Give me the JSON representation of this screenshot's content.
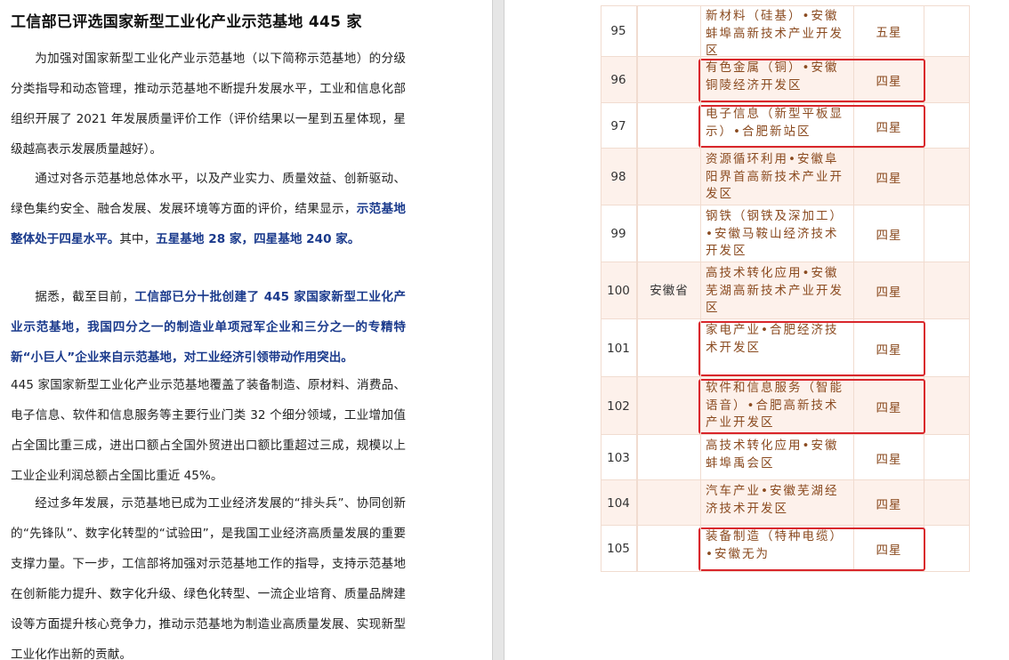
{
  "document": {
    "title": "工信部已评选国家新型工业化产业示范基地 445 家",
    "p1": "为加强对国家新型工业化产业示范基地（以下简称示范基地）的分级分类指导和动态管理，推动示范基地不断提升发展水平，工业和信息化部组织开展了 2021 年发展质量评价工作（评价结果以一星到五星体现，星级越高表示发展质量越好）。",
    "p2_plain": "通过对各示范基地总体水平，以及产业实力、质量效益、创新驱动、绿色集约安全、融合发展、发展环境等方面的评价，结果显示，",
    "p2_em1": "示范基地整体处于四星水平。",
    "p2_plain2": "其中，",
    "p2_em2": "五星基地 28 家，四星基地 240 家。",
    "p3_plain": "据悉，截至目前，",
    "p3_em": "工信部已分十批创建了 445 家国家新型工业化产业示范基地，我国四分之一的制造业单项冠军企业和三分之一的专精特新“小巨人”企业来自示范基地，对工业经济引领带动作用突出。",
    "p4": "445 家国家新型工业化产业示范基地覆盖了装备制造、原材料、消费品、电子信息、软件和信息服务等主要行业门类 32 个细分领域，工业增加值占全国比重三成，进出口额占全国外贸进出口额比重超过三成，规模以上工业企业利润总额占全国比重近 45%。",
    "p5": "经过多年发展，示范基地已成为工业经济发展的“排头兵”、协同创新的“先锋队”、数字化转型的“试验田”，是我国工业经济高质量发展的重要支撑力量。下一步，工信部将加强对示范基地工作的指导，支持示范基地在创新能力提升、数字化升级、绿色化转型、一流企业培育、质量品牌建设等方面提升核心竞争力，推动示范基地为制造业高质量发展、实现新型工业化作出新的贡献。"
  },
  "table": {
    "province": "安徽省",
    "rows": [
      {
        "idx": "95",
        "name": "新材料（硅基）•安徽蚌埠高新技术产业开发区",
        "star": "五星",
        "highlight": false
      },
      {
        "idx": "96",
        "name": "有色金属（铜）•安徽铜陵经济开发区",
        "star": "四星",
        "highlight": true
      },
      {
        "idx": "97",
        "name": "电子信息（新型平板显示）•合肥新站区",
        "star": "四星",
        "highlight": true
      },
      {
        "idx": "98",
        "name": "资源循环利用•安徽阜阳界首高新技术产业开发区",
        "star": "四星",
        "highlight": false
      },
      {
        "idx": "99",
        "name": "钢铁（钢铁及深加工）•安徽马鞍山经济技术开发区",
        "star": "四星",
        "highlight": false
      },
      {
        "idx": "100",
        "name": "高技术转化应用•安徽芜湖高新技术产业开发区",
        "star": "四星",
        "highlight": false
      },
      {
        "idx": "101",
        "name": "家电产业•合肥经济技术开发区",
        "star": "四星",
        "highlight": true
      },
      {
        "idx": "102",
        "name": "软件和信息服务（智能语音）•合肥高新技术产业开发区",
        "star": "四星",
        "highlight": true
      },
      {
        "idx": "103",
        "name": "高技术转化应用•安徽蚌埠禹会区",
        "star": "四星",
        "highlight": false
      },
      {
        "idx": "104",
        "name": "汽车产业•安徽芜湖经济技术开发区",
        "star": "四星",
        "highlight": false
      },
      {
        "idx": "105",
        "name": "装备制造（特种电缆）•安徽无为",
        "star": "四星",
        "highlight": true
      }
    ]
  },
  "colors": {
    "emphasis": "#1a3a8c",
    "row_tint": "#fdf1eb",
    "cell_text": "#8a4a1f",
    "highlight_border": "#d9262b"
  }
}
